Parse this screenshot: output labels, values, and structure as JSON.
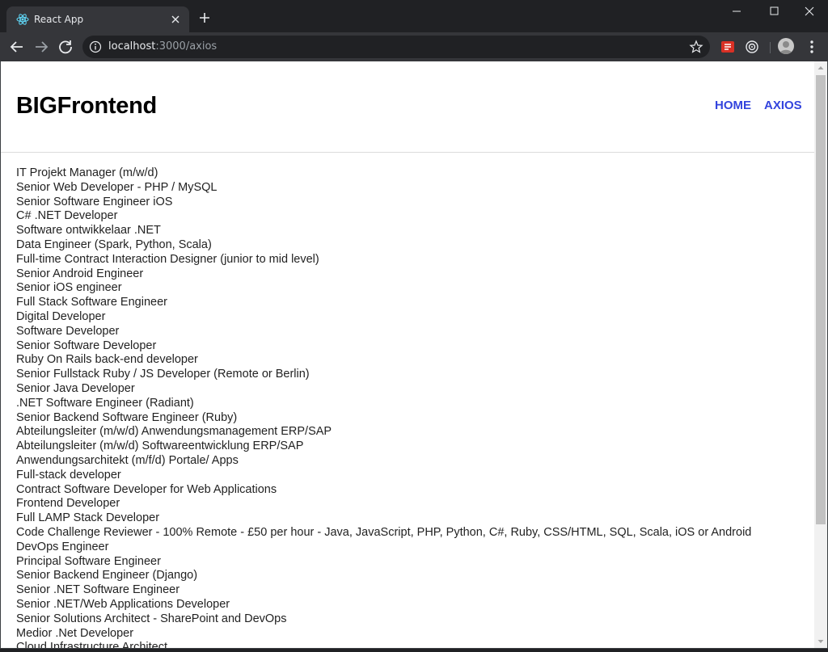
{
  "browser": {
    "tab_title": "React App",
    "url_host": "localhost",
    "url_path": ":3000/axios",
    "colors": {
      "frame": "#202124",
      "toolbar": "#35363a",
      "accent_ext": "#d93025"
    }
  },
  "site": {
    "brand": "BIGFrontend",
    "nav": {
      "home": "HOME",
      "axios": "AXIOS"
    },
    "link_color": "#3344dd"
  },
  "jobs": [
    "IT Projekt Manager (m/w/d)",
    "Senior Web Developer - PHP / MySQL",
    "Senior Software Engineer iOS",
    "C# .NET Developer",
    "Software ontwikkelaar .NET",
    "Data Engineer (Spark, Python, Scala)",
    "Full-time Contract Interaction Designer (junior to mid level)",
    "Senior Android Engineer",
    "Senior iOS engineer",
    "Full Stack Software Engineer",
    "Digital Developer",
    "Software Developer",
    "Senior Software Developer",
    "Ruby On Rails back-end developer",
    "Senior Fullstack Ruby / JS Developer (Remote or Berlin)",
    "Senior Java Developer",
    ".NET Software Engineer (Radiant)",
    "Senior Backend Software Engineer (Ruby)",
    "Abteilungsleiter (m/w/d) Anwendungsmanagement ERP/SAP",
    "Abteilungsleiter (m/w/d) Softwareentwicklung ERP/SAP",
    "Anwendungsarchitekt (m/f/d) Portale/ Apps",
    "Full-stack developer",
    "Contract Software Developer for Web Applications",
    "Frontend Developer",
    "Full LAMP Stack Developer",
    "Code Challenge Reviewer - 100% Remote - £50 per hour - Java, JavaScript, PHP, Python, C#, Ruby, CSS/HTML, SQL, Scala, iOS or Android",
    "DevOps Engineer",
    "Principal Software Engineer",
    "Senior Backend Engineer (Django)",
    "Senior .NET Software Engineer",
    "Senior .NET/Web Applications Developer",
    "Senior Solutions Architect - SharePoint and DevOps",
    "Medior .Net Developer",
    "Cloud Infrastructure Architect"
  ]
}
